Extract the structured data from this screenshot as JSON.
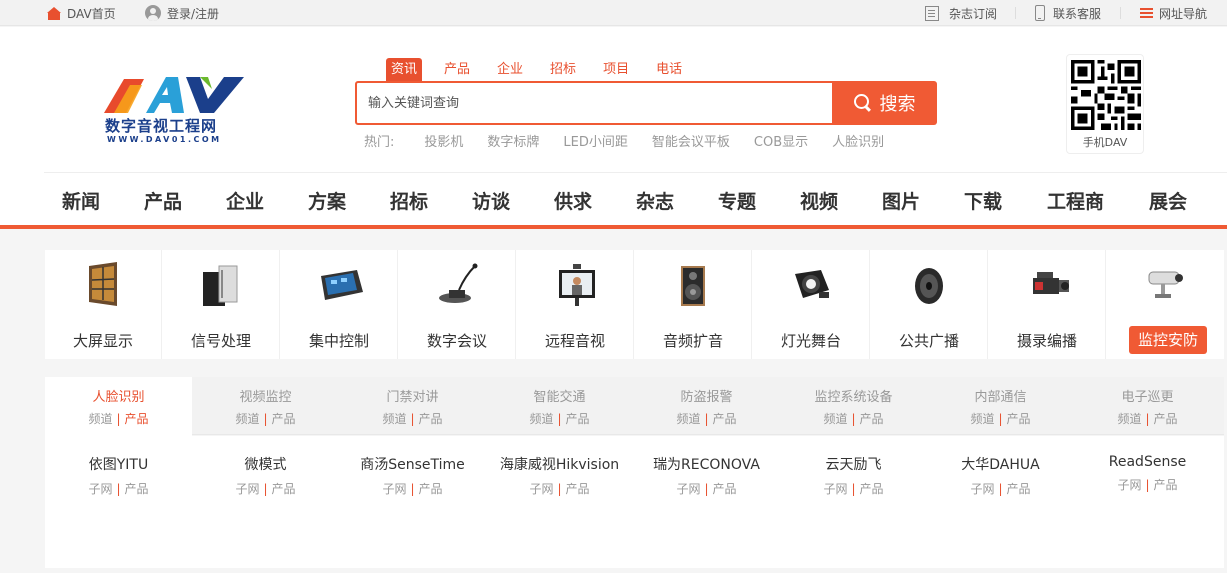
{
  "topbar": {
    "home": "DAV首页",
    "login": "登录/注册",
    "subscribe": "杂志订阅",
    "contact": "联系客服",
    "sitemap": "网址导航",
    "icons": [
      "home-icon",
      "user-icon",
      "magazine-icon",
      "phone-icon",
      "menu-icon"
    ]
  },
  "logo": {
    "mark": "DAV",
    "name": "数字音视工程网",
    "url": "WWW.DAV01.COM"
  },
  "search": {
    "tabs": [
      "资讯",
      "产品",
      "企业",
      "招标",
      "项目",
      "电话"
    ],
    "active_tab": "资讯",
    "placeholder": "输入关键词查询",
    "button": "搜索",
    "hot_label": "热门:",
    "hot": [
      "投影机",
      "数字标牌",
      "LED小间距",
      "智能会议平板",
      "COB显示",
      "人脸识别"
    ]
  },
  "qr": {
    "label": "手机DAV"
  },
  "nav": [
    "新闻",
    "产品",
    "企业",
    "方案",
    "招标",
    "访谈",
    "供求",
    "杂志",
    "专题",
    "视频",
    "图片",
    "下载",
    "工程商",
    "展会"
  ],
  "categories": [
    "大屏显示",
    "信号处理",
    "集中控制",
    "数字会议",
    "远程音视",
    "音频扩音",
    "灯光舞台",
    "公共广播",
    "摄录编播",
    "监控安防"
  ],
  "active_category": "监控安防",
  "subtabs": {
    "items": [
      "人脸识别",
      "视频监控",
      "门禁对讲",
      "智能交通",
      "防盗报警",
      "监控系统设备",
      "内部通信",
      "电子巡更"
    ],
    "link_a": "频道",
    "link_b": "产品",
    "active": "人脸识别"
  },
  "brands": {
    "items": [
      "依图YITU",
      "微模式",
      "商汤SenseTime",
      "海康威视Hikvision",
      "瑞为RECONOVA",
      "云天励飞",
      "大华DAHUA",
      "ReadSense"
    ],
    "link_a": "子网",
    "link_b": "产品"
  },
  "colors": {
    "accent": "#f05a34",
    "logo_blue": "#1b3f8b"
  }
}
